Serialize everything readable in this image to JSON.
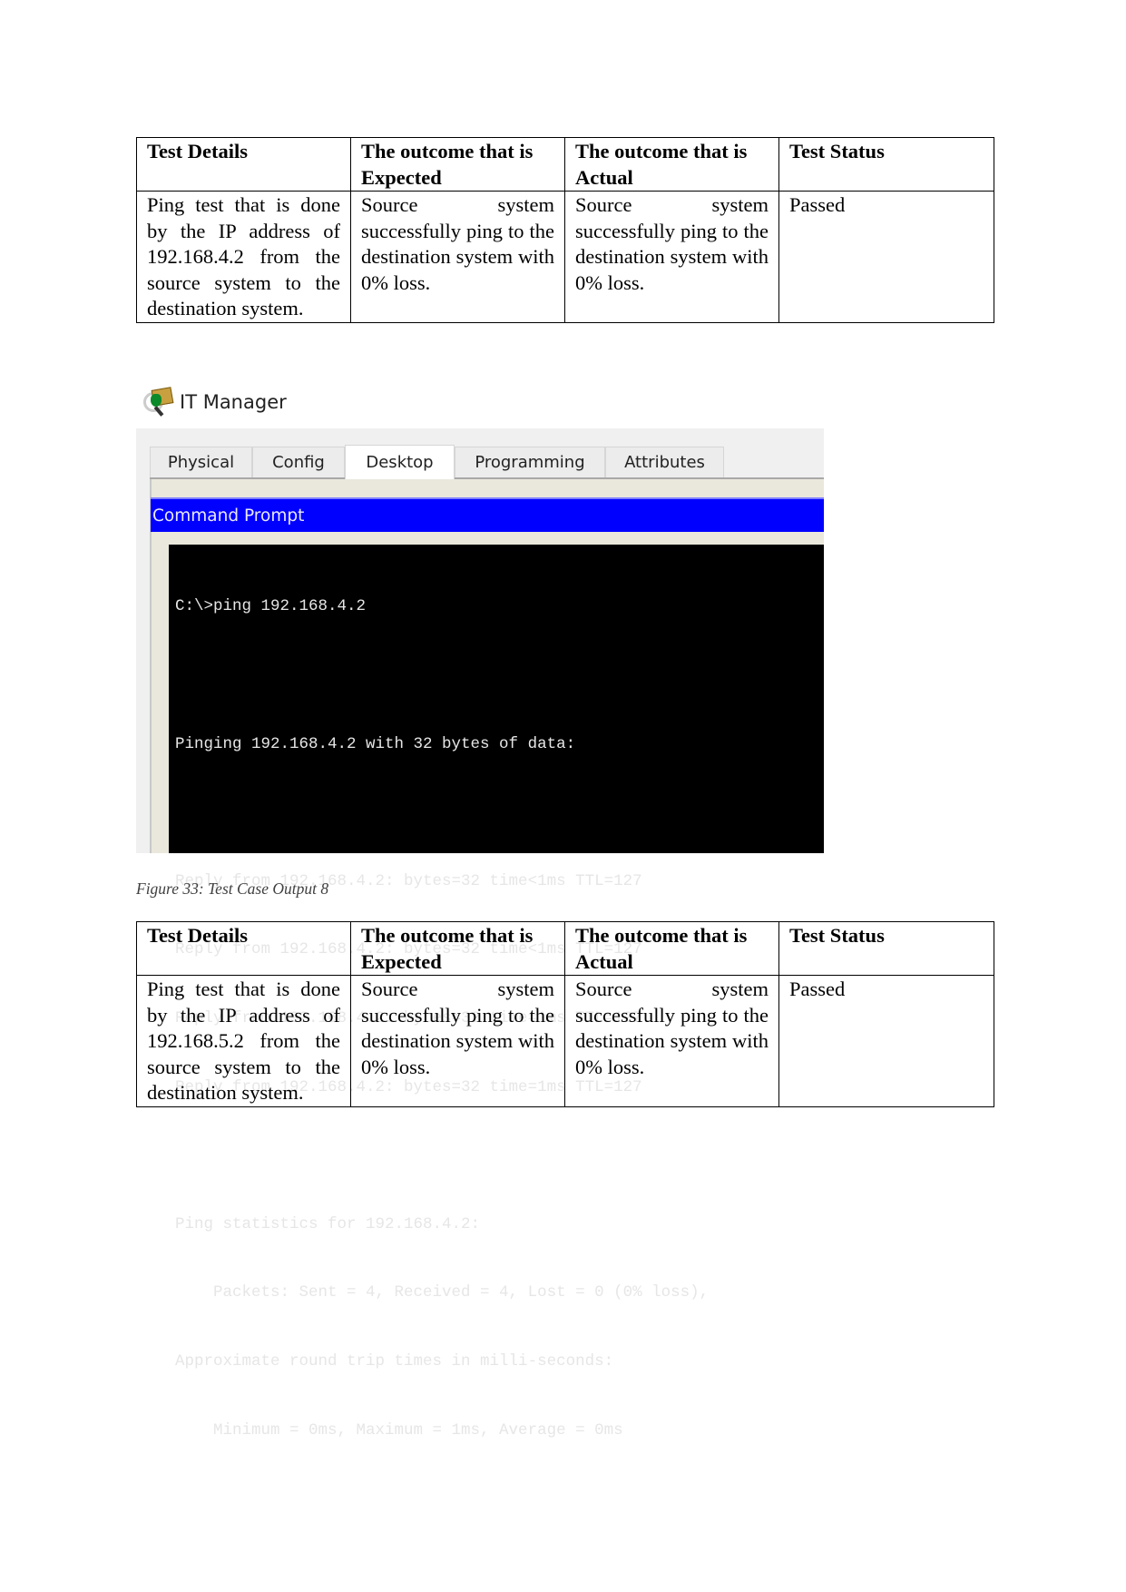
{
  "tables": [
    {
      "headers": [
        "Test Details",
        "The outcome that is Expected",
        "The outcome that is Actual",
        "Test Status"
      ],
      "row": {
        "details": "Ping test that is done by the IP address of 192.168.4.2 from the source system to the destination system.",
        "expected": "Source system successfully ping to the destination system with 0% loss.",
        "actual": "Source system successfully ping to the destination system with 0% loss.",
        "status": "Passed"
      }
    },
    {
      "headers": [
        "Test Details",
        "The outcome that is Expected",
        "The outcome that is Actual",
        "Test Status"
      ],
      "row": {
        "details": "Ping test that is done by the IP address of 192.168.5.2 from the source system to the destination system.",
        "expected": "Source system successfully ping to the destination system with 0% loss.",
        "actual": "Source system successfully ping to the destination system with 0% loss.",
        "status": "Passed"
      }
    }
  ],
  "screenshot": {
    "app_title": "IT Manager",
    "app_icon": "it-manager-icon",
    "tabs": [
      {
        "label": "Physical",
        "active": false
      },
      {
        "label": "Config",
        "active": false
      },
      {
        "label": "Desktop",
        "active": true
      },
      {
        "label": "Programming",
        "active": false
      },
      {
        "label": "Attributes",
        "active": false
      }
    ],
    "panel_title": "Command Prompt",
    "accent_color": "#0000ff",
    "terminal_lines": [
      "C:\\>ping 192.168.4.2",
      "",
      "Pinging 192.168.4.2 with 32 bytes of data:",
      "",
      "Reply from 192.168.4.2: bytes=32 time<1ms TTL=127",
      "Reply from 192.168.4.2: bytes=32 time<1ms TTL=127",
      "Reply from 192.168.4.2: bytes=32 time=1ms TTL=127",
      "Reply from 192.168.4.2: bytes=32 time=1ms TTL=127",
      "",
      "Ping statistics for 192.168.4.2:",
      "    Packets: Sent = 4, Received = 4, Lost = 0 (0% loss),",
      "Approximate round trip times in milli-seconds:",
      "    Minimum = 0ms, Maximum = 1ms, Average = 0ms"
    ]
  },
  "caption": "Figure 33: Test Case Output 8"
}
